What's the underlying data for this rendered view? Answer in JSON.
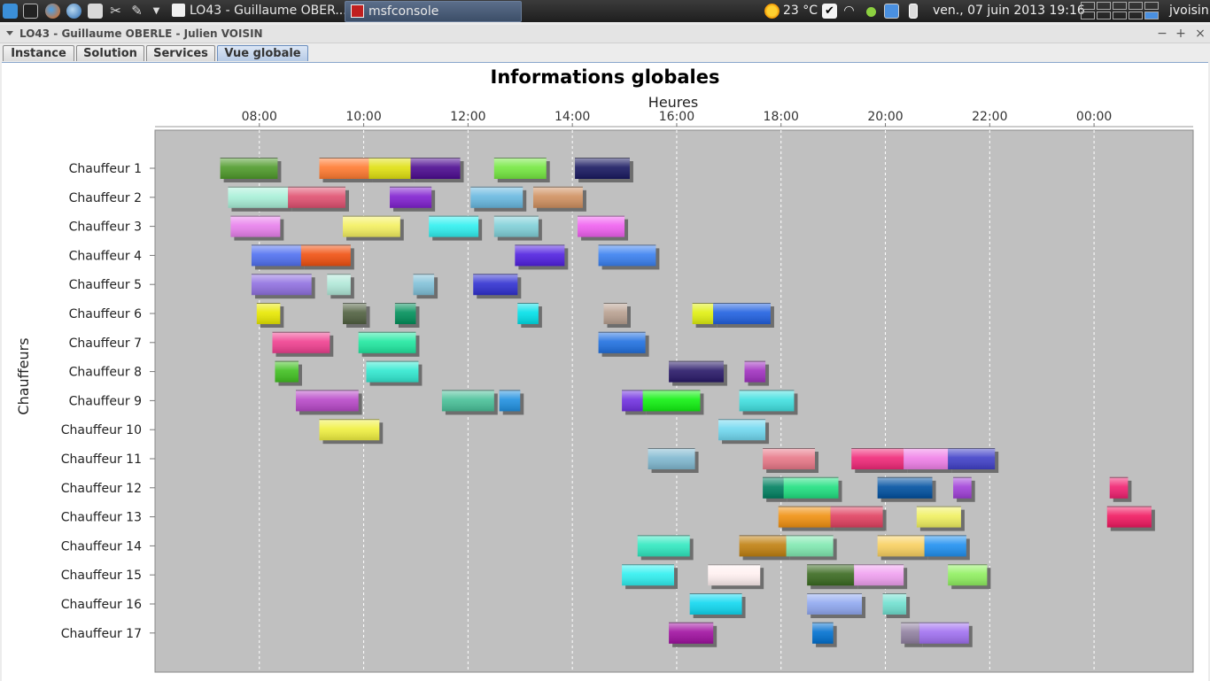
{
  "panel": {
    "task_window_title": "LO43 - Guillaume OBER...",
    "task_terminal_title": "msfconsole",
    "weather": "23 °C",
    "clock": "ven., 07 juin 2013 19:16",
    "user": "jvoisin"
  },
  "window": {
    "title": "LO43 - Guillaume OBERLE - Julien VOISIN",
    "min_glyph": "−",
    "max_glyph": "+",
    "close_glyph": "×"
  },
  "tabs": [
    {
      "label": "Instance",
      "selected": false
    },
    {
      "label": "Solution",
      "selected": false
    },
    {
      "label": "Services",
      "selected": false
    },
    {
      "label": "Vue globale",
      "selected": true
    }
  ],
  "chart_data": {
    "type": "gantt",
    "title": "Informations globales",
    "xlabel": "Heures",
    "ylabel": "Chauffeurs",
    "x_ticks": [
      "08:00",
      "10:00",
      "12:00",
      "14:00",
      "16:00",
      "18:00",
      "20:00",
      "22:00",
      "00:00"
    ],
    "x_range_hours": [
      6.0,
      25.9
    ],
    "grid": true,
    "rows": [
      {
        "label": "Chauffeur 1",
        "tasks": [
          [
            7.25,
            8.35,
            "#4e9a2a"
          ],
          [
            9.15,
            10.1,
            "#ff7a30"
          ],
          [
            10.1,
            10.9,
            "#e0e010"
          ],
          [
            10.9,
            11.85,
            "#4c0a90"
          ],
          [
            12.5,
            13.5,
            "#74e840"
          ],
          [
            14.05,
            15.1,
            "#181860"
          ]
        ]
      },
      {
        "label": "Chauffeur 2",
        "tasks": [
          [
            7.4,
            8.55,
            "#a8f0d8"
          ],
          [
            8.55,
            9.65,
            "#e05070"
          ],
          [
            10.5,
            11.3,
            "#8020d0"
          ],
          [
            12.05,
            13.05,
            "#68b8e0"
          ],
          [
            13.25,
            14.2,
            "#d09060"
          ]
        ]
      },
      {
        "label": "Chauffeur 3",
        "tasks": [
          [
            7.45,
            8.4,
            "#e880ec"
          ],
          [
            9.6,
            10.7,
            "#f4f060"
          ],
          [
            11.25,
            12.2,
            "#30f0f0"
          ],
          [
            12.5,
            13.35,
            "#80d0d8"
          ],
          [
            14.1,
            15.0,
            "#f060f0"
          ]
        ]
      },
      {
        "label": "Chauffeur 4",
        "tasks": [
          [
            7.85,
            8.8,
            "#5070f0"
          ],
          [
            8.8,
            9.75,
            "#f05010"
          ],
          [
            12.9,
            13.85,
            "#5020e0"
          ],
          [
            14.5,
            15.6,
            "#3a80f0"
          ]
        ]
      },
      {
        "label": "Chauffeur 5",
        "tasks": [
          [
            7.85,
            9.0,
            "#9070e0"
          ],
          [
            9.3,
            9.75,
            "#b0e8d8"
          ],
          [
            10.95,
            11.35,
            "#80c0d8"
          ],
          [
            12.1,
            12.95,
            "#3030d0"
          ]
        ]
      },
      {
        "label": "Chauffeur 6",
        "tasks": [
          [
            7.95,
            8.4,
            "#e8e800"
          ],
          [
            9.6,
            10.05,
            "#506040"
          ],
          [
            10.6,
            11.0,
            "#00905a"
          ],
          [
            12.95,
            13.35,
            "#00e0e8"
          ],
          [
            14.6,
            15.05,
            "#b8a090"
          ],
          [
            16.3,
            16.7,
            "#e0f010"
          ],
          [
            16.7,
            17.8,
            "#2060e0"
          ]
        ]
      },
      {
        "label": "Chauffeur 7",
        "tasks": [
          [
            8.25,
            9.35,
            "#f04090"
          ],
          [
            9.9,
            11.0,
            "#20e8a0"
          ],
          [
            14.5,
            15.4,
            "#2070e0"
          ]
        ]
      },
      {
        "label": "Chauffeur 8",
        "tasks": [
          [
            8.3,
            8.75,
            "#40c020"
          ],
          [
            10.05,
            11.05,
            "#30e8d0"
          ],
          [
            15.85,
            16.9,
            "#281868"
          ],
          [
            17.3,
            17.7,
            "#a030c0"
          ]
        ]
      },
      {
        "label": "Chauffeur 9",
        "tasks": [
          [
            8.7,
            9.9,
            "#b848c8"
          ],
          [
            11.5,
            12.5,
            "#48c098"
          ],
          [
            12.6,
            13.0,
            "#2090e0"
          ],
          [
            14.95,
            15.35,
            "#7030e0"
          ],
          [
            15.35,
            16.45,
            "#10f010"
          ],
          [
            17.2,
            18.25,
            "#40e0e0"
          ]
        ]
      },
      {
        "label": "Chauffeur 10",
        "tasks": [
          [
            9.15,
            10.3,
            "#f0f040"
          ],
          [
            16.8,
            17.7,
            "#70d8f0"
          ]
        ]
      },
      {
        "label": "Chauffeur 11",
        "tasks": [
          [
            15.45,
            16.35,
            "#80b8d0"
          ],
          [
            17.65,
            18.65,
            "#e87888"
          ],
          [
            19.35,
            20.35,
            "#f02878"
          ],
          [
            20.35,
            21.2,
            "#f080e8"
          ],
          [
            21.2,
            22.1,
            "#4040c8"
          ]
        ]
      },
      {
        "label": "Chauffeur 12",
        "tasks": [
          [
            17.65,
            18.05,
            "#008060"
          ],
          [
            18.05,
            19.1,
            "#20e080"
          ],
          [
            19.85,
            20.9,
            "#0050a0"
          ],
          [
            21.3,
            21.65,
            "#a040d8"
          ],
          [
            24.3,
            24.65,
            "#f02070"
          ]
        ]
      },
      {
        "label": "Chauffeur 13",
        "tasks": [
          [
            17.95,
            18.95,
            "#f09010"
          ],
          [
            18.95,
            19.95,
            "#e04060"
          ],
          [
            20.6,
            21.45,
            "#f0f060"
          ],
          [
            24.25,
            25.1,
            "#f01860"
          ]
        ]
      },
      {
        "label": "Chauffeur 14",
        "tasks": [
          [
            15.25,
            16.25,
            "#30e8c0"
          ],
          [
            17.2,
            18.1,
            "#c08010"
          ],
          [
            18.1,
            19.0,
            "#80e8b0"
          ],
          [
            19.85,
            20.75,
            "#f8d060"
          ],
          [
            20.75,
            21.55,
            "#2090f0"
          ]
        ]
      },
      {
        "label": "Chauffeur 15",
        "tasks": [
          [
            14.95,
            15.95,
            "#30f0f0"
          ],
          [
            16.6,
            17.6,
            "#fff0f0"
          ],
          [
            18.5,
            19.4,
            "#3a6a20"
          ],
          [
            19.4,
            20.35,
            "#f0a0f0"
          ],
          [
            21.2,
            21.95,
            "#90f060"
          ]
        ]
      },
      {
        "label": "Chauffeur 16",
        "tasks": [
          [
            16.25,
            17.25,
            "#10d8f0"
          ],
          [
            18.5,
            19.55,
            "#90a8f0"
          ],
          [
            19.95,
            20.4,
            "#70e0d0"
          ]
        ]
      },
      {
        "label": "Chauffeur 17",
        "tasks": [
          [
            15.85,
            16.7,
            "#a010a0"
          ],
          [
            18.6,
            19.0,
            "#0070d0"
          ],
          [
            20.3,
            20.65,
            "#9080a0"
          ],
          [
            20.65,
            21.6,
            "#a070f0"
          ]
        ]
      }
    ]
  }
}
